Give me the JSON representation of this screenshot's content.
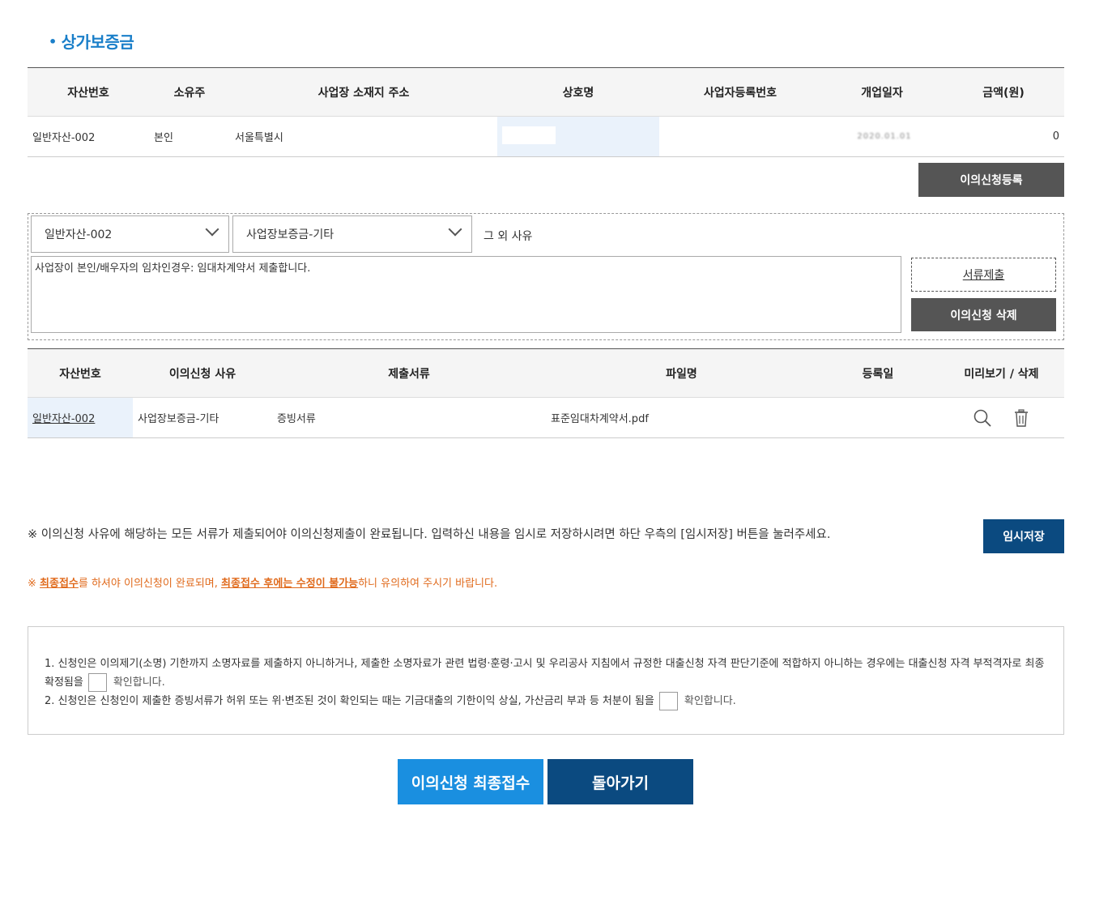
{
  "section": {
    "title": "상가보증금"
  },
  "table1": {
    "headers": [
      "자산번호",
      "소유주",
      "사업장 소재지 주소",
      "상호명",
      "사업자등록번호",
      "개업일자",
      "금액(원)"
    ],
    "rows": [
      {
        "asset_no": "일반자산-002",
        "owner": "본인",
        "address": "서울특별시",
        "business_name": "",
        "biz_reg_no": "",
        "open_date": "2020.01.01",
        "amount": "0"
      }
    ]
  },
  "buttons": {
    "register_objection": "이의신청등록",
    "submit_docs": "서류제출",
    "delete_objection": "이의신청 삭제",
    "temp_save": "임시저장",
    "final_submit": "이의신청 최종접수",
    "go_back": "돌아가기"
  },
  "objection_form": {
    "asset_select": "일반자산-002",
    "reason_select": "사업장보증금-기타",
    "other_reason_label": "그 외 사유",
    "reason_text": "사업장이 본인/배우자의 임차인경우: 임대차계약서 제출합니다."
  },
  "table2": {
    "headers": [
      "자산번호",
      "이의신청 사유",
      "제출서류",
      "파일명",
      "등록일",
      "미리보기 / 삭제"
    ],
    "rows": [
      {
        "asset_no": "일반자산-002",
        "reason": "사업장보증금-기타",
        "doc": "증빙서류",
        "filename": "표준임대차계약서.pdf",
        "reg_date": ""
      }
    ]
  },
  "notice": "※ 이의신청 사유에 해당하는 모든 서류가 제출되어야 이의신청제출이 완료됩니다. 입력하신 내용을 임시로 저장하시려면 하단 우측의 [임시저장] 버튼을 눌러주세요.",
  "warning": {
    "prefix": "※ ",
    "b1": "최종접수",
    "t1": "를 하셔야 이의신청이 완료되며, ",
    "b2": "최종접수 후에는 수정이 불가능",
    "t2": "하니 유의하여 주시기 바랍니다."
  },
  "agreement": {
    "item1": "1. 신청인은 이의제기(소명) 기한까지 소명자료를 제출하지 아니하거나, 제출한 소명자료가 관련 법령·훈령·고시 및 우리공사 지침에서 규정한 대출신청 자격 판단기준에 적합하지 아니하는 경우에는 대출신청 자격 부적격자로 최종 확정됨을",
    "item2": "2. 신청인은 신청인이 제출한 증빙서류가 허위 또는 위·변조된 것이 확인되는 때는 기금대출의 기한이익 상실, 가산금리 부과 등 처분이 됨을",
    "confirm": "확인합니다."
  },
  "colors": {
    "accent": "#1a7fc9",
    "navy": "#0b4a80",
    "blue": "#1a8fe0",
    "warn": "#e06a1c",
    "dark_btn": "#555555"
  },
  "icons": {
    "preview": "search-icon",
    "delete": "trash-icon"
  }
}
